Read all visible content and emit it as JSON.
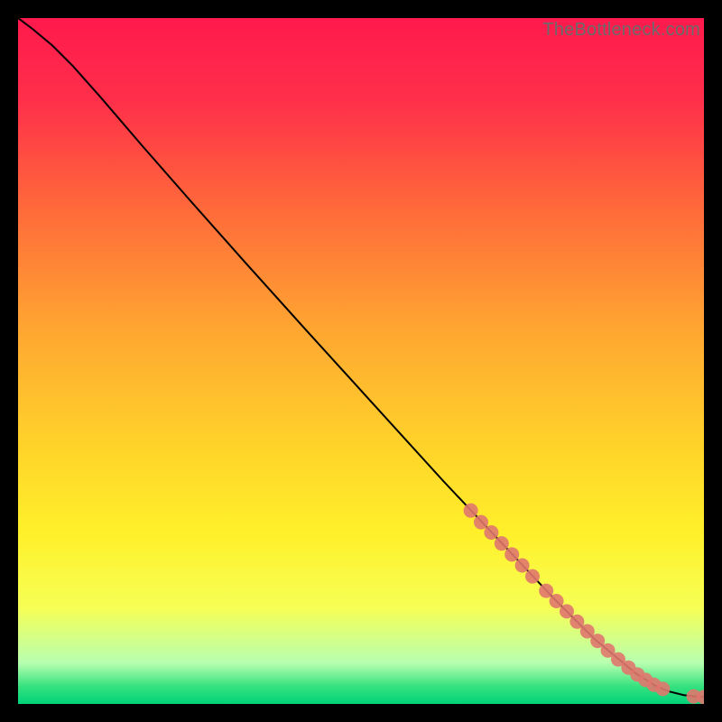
{
  "watermark": "TheBottleneck.com",
  "chart_data": {
    "type": "line",
    "title": "",
    "xlabel": "",
    "ylabel": "",
    "xlim": [
      0,
      100
    ],
    "ylim": [
      0,
      100
    ],
    "grid": false,
    "background_gradient": [
      {
        "stop": 0.0,
        "color": "#ff1a4d"
      },
      {
        "stop": 0.12,
        "color": "#ff2f4a"
      },
      {
        "stop": 0.28,
        "color": "#ff6a3a"
      },
      {
        "stop": 0.45,
        "color": "#ffa531"
      },
      {
        "stop": 0.62,
        "color": "#ffd22a"
      },
      {
        "stop": 0.75,
        "color": "#fff02a"
      },
      {
        "stop": 0.86,
        "color": "#f6ff55"
      },
      {
        "stop": 0.94,
        "color": "#b8ffb0"
      },
      {
        "stop": 0.975,
        "color": "#35e17e"
      },
      {
        "stop": 1.0,
        "color": "#00d27a"
      }
    ],
    "series": [
      {
        "name": "curve",
        "color": "#000000",
        "x": [
          0,
          2,
          5,
          8,
          12,
          18,
          25,
          33,
          42,
          52,
          62,
          70,
          78,
          84,
          90,
          93,
          95,
          97,
          98.5,
          100
        ],
        "y": [
          100,
          98.5,
          96,
          93,
          88.5,
          81.5,
          73.5,
          64.5,
          54.5,
          43.5,
          32.5,
          24,
          15.5,
          9.5,
          4.5,
          2.6,
          1.8,
          1.3,
          1.1,
          1.0
        ]
      }
    ],
    "points": {
      "name": "markers",
      "color": "#e0776e",
      "radius": 8,
      "xy": [
        [
          66,
          28.2
        ],
        [
          67.5,
          26.5
        ],
        [
          69,
          25.0
        ],
        [
          70.5,
          23.4
        ],
        [
          72,
          21.8
        ],
        [
          73.5,
          20.2
        ],
        [
          75,
          18.6
        ],
        [
          77,
          16.5
        ],
        [
          78.5,
          15.0
        ],
        [
          80,
          13.5
        ],
        [
          81.5,
          12.0
        ],
        [
          83,
          10.6
        ],
        [
          84.5,
          9.2
        ],
        [
          86,
          7.8
        ],
        [
          87.5,
          6.5
        ],
        [
          89,
          5.3
        ],
        [
          90.3,
          4.3
        ],
        [
          91.5,
          3.5
        ],
        [
          92.7,
          2.8
        ],
        [
          94,
          2.2
        ],
        [
          98.5,
          1.1
        ],
        [
          100,
          1.0
        ]
      ]
    }
  }
}
